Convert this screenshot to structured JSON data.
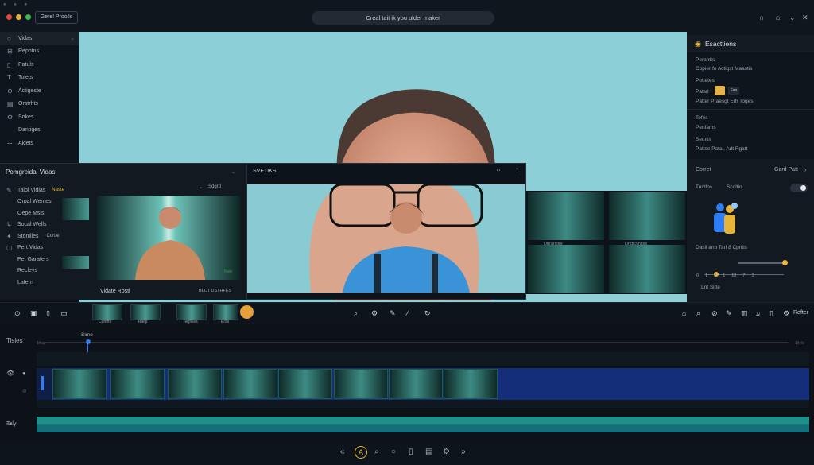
{
  "window": {
    "mini_controls": "● ● ●",
    "app_tab": "Gerel Proolls",
    "search_text": "Creal tait ik you ulder maker"
  },
  "colors": {
    "close": "#e24a3b",
    "minimize": "#e7b43a",
    "maximize": "#3fb950",
    "accent": "#2e7cf6",
    "track_teal": "#1f8f8a",
    "track_blue": "#142e7a"
  },
  "sidebar": {
    "items": [
      {
        "icon": "circle-icon",
        "label": "Vidas"
      },
      {
        "icon": "grid-icon",
        "label": "Rephtns"
      },
      {
        "icon": "doc-icon",
        "label": "Patuls"
      },
      {
        "icon": "text-icon",
        "label": "Tolets"
      },
      {
        "icon": "adjust-icon",
        "label": "Actigeste"
      },
      {
        "icon": "chart-icon",
        "label": "Orstrhts"
      },
      {
        "icon": "settings-icon",
        "label": "Sokes"
      },
      {
        "icon": "",
        "label": "Dantiges"
      },
      {
        "icon": "plus-icon",
        "label": "Aklets"
      }
    ]
  },
  "right_panel": {
    "title": "Esacttiens",
    "lines": [
      "Perantts",
      "Copier fo Actigst Maastis",
      "Pottetes",
      "Patsrl",
      "Fao",
      "Patter Praesgt Erh Toges",
      "Tofes",
      "Penfams",
      "Sethtis",
      "Pattse Patal, Adt Rgatt"
    ],
    "correct_label": "Corret",
    "gard_label": "Gard Patt",
    "tab1": "Tuntlos",
    "tab2": "Scoltio",
    "slider_label": "Dasil anb Tarl 8 Cpritis",
    "ticks": [
      "0",
      "1",
      "8",
      "1",
      "18",
      "7",
      "1"
    ],
    "small_label": "Lnt Sitte"
  },
  "browser": {
    "title": "Pomgreidal Vidas",
    "items": [
      {
        "icon": "pen-icon",
        "label": "Taiol Vidias",
        "badge": "Naste"
      },
      {
        "icon": "",
        "label": "Orpal Wentes"
      },
      {
        "icon": "",
        "label": "Oepe Msls"
      },
      {
        "icon": "flow-icon",
        "label": "Socal Wells"
      },
      {
        "icon": "sparkle-icon",
        "label": "Stonilles",
        "badge": "Cortle"
      },
      {
        "icon": "frame-icon",
        "label": "Pert Vidas"
      },
      {
        "icon": "",
        "label": "Pet Garaters"
      },
      {
        "icon": "",
        "label": "Recleys"
      },
      {
        "icon": "",
        "label": "Latern"
      }
    ],
    "right_label": "Sdgrd",
    "view_caption": "Vidate Rostl",
    "view_caption2": "BLCT DSTHFES",
    "badge_bottom": "Nee"
  },
  "editor": {
    "title": "SVETIKS",
    "menu": "⋯"
  },
  "thumbs": {
    "captions": [
      "Dnrarjitire",
      "Dndicyntiss",
      "",
      ""
    ]
  },
  "toolrow": {
    "mini_captions": [
      "Comfre",
      "Rielp",
      "Terpikes",
      "Erall"
    ],
    "right_label": "Refter"
  },
  "timeline": {
    "label": "Tisles",
    "marker": "Sime",
    "ruler_left": "1/lcp",
    "ruler_right": "1/ly/s",
    "track2_label": "Taly"
  }
}
